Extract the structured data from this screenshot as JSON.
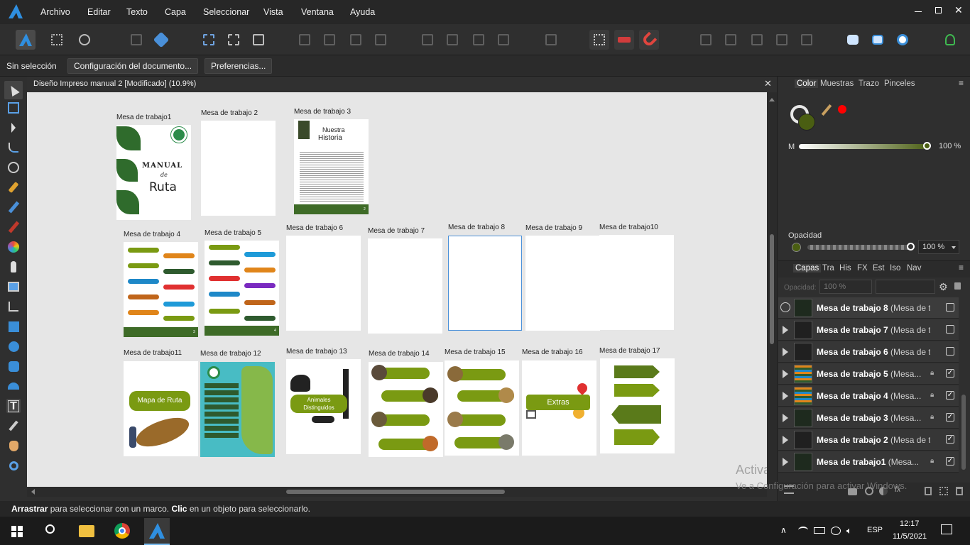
{
  "menu": {
    "items": [
      "Archivo",
      "Editar",
      "Texto",
      "Capa",
      "Seleccionar",
      "Vista",
      "Ventana",
      "Ayuda"
    ]
  },
  "context": {
    "status": "Sin selección",
    "doc_settings": "Configuración del documento...",
    "prefs": "Preferencias..."
  },
  "document": {
    "title": "Diseño Impreso manual 2 [Modificado] (10.9%)"
  },
  "artboards": [
    {
      "label": "Mesa de trabajo1",
      "text1": "MANUAL",
      "text2": "de",
      "text3": "Ruta"
    },
    {
      "label": "Mesa de trabajo 2"
    },
    {
      "label": "Mesa de trabajo 3",
      "text1": "Nuestra",
      "text2": "Historia",
      "page": "2"
    },
    {
      "label": "Mesa de trabajo 4",
      "page": "3"
    },
    {
      "label": "Mesa de trabajo 5",
      "page": "4"
    },
    {
      "label": "Mesa de trabajo 6"
    },
    {
      "label": "Mesa de trabajo 7"
    },
    {
      "label": "Mesa de trabajo 8"
    },
    {
      "label": "Mesa de trabajo 9"
    },
    {
      "label": "Mesa de trabajo10"
    },
    {
      "label": "Mesa de trabajo11",
      "text1": "Mapa de Ruta"
    },
    {
      "label": "Mesa de trabajo 12"
    },
    {
      "label": "Mesa de trabajo 13",
      "text1": "Animales",
      "text2": "Distinguidos"
    },
    {
      "label": "Mesa de trabajo 14"
    },
    {
      "label": "Mesa de trabajo 15"
    },
    {
      "label": "Mesa de trabajo 16",
      "text1": "Extras"
    },
    {
      "label": "Mesa de trabajo 17"
    }
  ],
  "color_panel": {
    "tabs": [
      "Color",
      "Muestras",
      "Trazo",
      "Pinceles"
    ],
    "slider_label": "M",
    "slider_value": "100 %",
    "opacity_label": "Opacidad",
    "opacity_value": "100 %",
    "fill_color": "#4a5e12",
    "stroke_color": "#ff0000"
  },
  "layers_panel": {
    "tabs": [
      "Capas",
      "Tra",
      "His",
      "FX",
      "Est",
      "Iso",
      "Nav"
    ],
    "opacity_label": "Opacidad:",
    "opacity_value": "100 %",
    "layers": [
      {
        "name": "Mesa de trabajo 8",
        "suffix": " (Mesa de t...",
        "locked": false,
        "visible": false,
        "selected": true
      },
      {
        "name": "Mesa de trabajo 7",
        "suffix": " (Mesa de t...",
        "locked": false,
        "visible": false
      },
      {
        "name": "Mesa de trabajo 6",
        "suffix": " (Mesa de t...",
        "locked": false,
        "visible": false
      },
      {
        "name": "Mesa de trabajo 5",
        "suffix": " (Mesa...",
        "locked": true,
        "visible": true
      },
      {
        "name": "Mesa de trabajo 4",
        "suffix": " (Mesa...",
        "locked": true,
        "visible": true
      },
      {
        "name": "Mesa de trabajo 3",
        "suffix": " (Mesa...",
        "locked": true,
        "visible": true
      },
      {
        "name": "Mesa de trabajo 2",
        "suffix": " (Mesa de t...",
        "locked": false,
        "visible": true
      },
      {
        "name": "Mesa de trabajo1",
        "suffix": " (Mesa...",
        "locked": true,
        "visible": true
      }
    ]
  },
  "status": {
    "b1": "Arrastrar",
    "t1": " para seleccionar con un marco. ",
    "b2": "Clic",
    "t2": " en un objeto para seleccionarlo."
  },
  "watermark": {
    "line1": "Activar Windows",
    "line2": "Ve a Configuración para activar Windows."
  },
  "taskbar": {
    "lang": "ESP",
    "time": "12:17",
    "date": "11/5/2021"
  }
}
